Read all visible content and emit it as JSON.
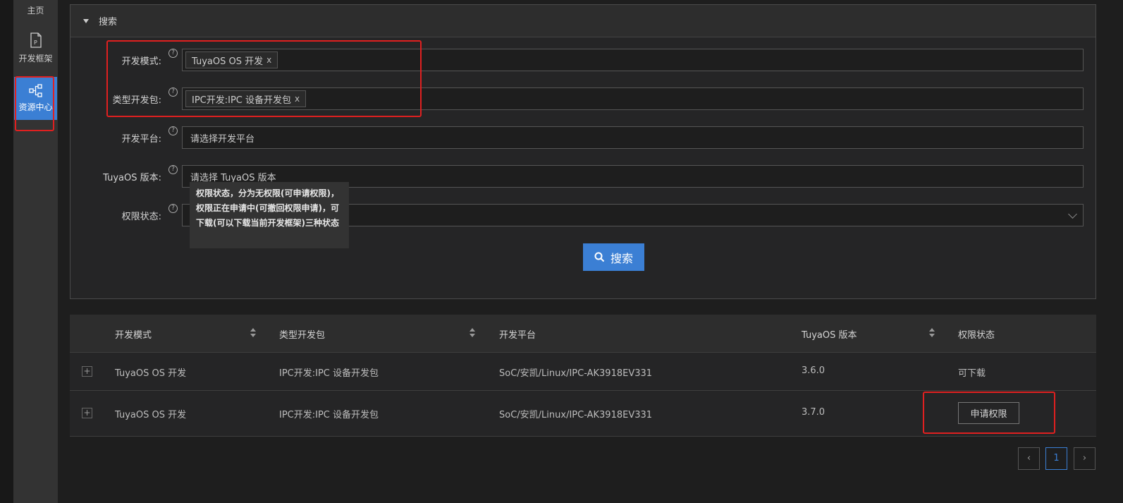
{
  "sidebar": {
    "home_label": "主页",
    "framework_label": "开发框架",
    "resource_label": "资源中心"
  },
  "search_panel": {
    "title": "搜索",
    "fields": [
      {
        "label": "开发模式:",
        "tag": "TuyaOS OS 开发",
        "placeholder": ""
      },
      {
        "label": "类型开发包:",
        "tag": "IPC开发:IPC 设备开发包",
        "placeholder": ""
      },
      {
        "label": "开发平台:",
        "tag": "",
        "placeholder": "请选择开发平台"
      },
      {
        "label": "TuyaOS 版本:",
        "tag": "",
        "placeholder": "请选择 TuyaOS 版本"
      },
      {
        "label": "权限状态:",
        "tag": "",
        "placeholder": ""
      }
    ],
    "help_glyph": "?",
    "tag_remove_glyph": "x",
    "search_button": "搜索",
    "tooltip": "权限状态，分为无权限(可申请权限)，权限正在申请中(可撤回权限申请)，可下载(可以下载当前开发框架)三种状态"
  },
  "table": {
    "headers": [
      "开发模式",
      "类型开发包",
      "开发平台",
      "TuyaOS 版本",
      "权限状态"
    ],
    "expand_glyph": "+",
    "rows": [
      {
        "mode": "TuyaOS OS 开发",
        "package": "IPC开发:IPC 设备开发包",
        "platform": "SoC/安凯/Linux/IPC-AK3918EV331",
        "version": "3.6.0",
        "status": "可下载"
      },
      {
        "mode": "TuyaOS OS 开发",
        "package": "IPC开发:IPC 设备开发包",
        "platform": "SoC/安凯/Linux/IPC-AK3918EV331",
        "version": "3.7.0",
        "status": "申请权限"
      }
    ]
  },
  "pagination": {
    "prev": "‹",
    "current": "1",
    "next": "›"
  },
  "colors": {
    "accent": "#3b7fd4",
    "annotation": "#e02020"
  }
}
